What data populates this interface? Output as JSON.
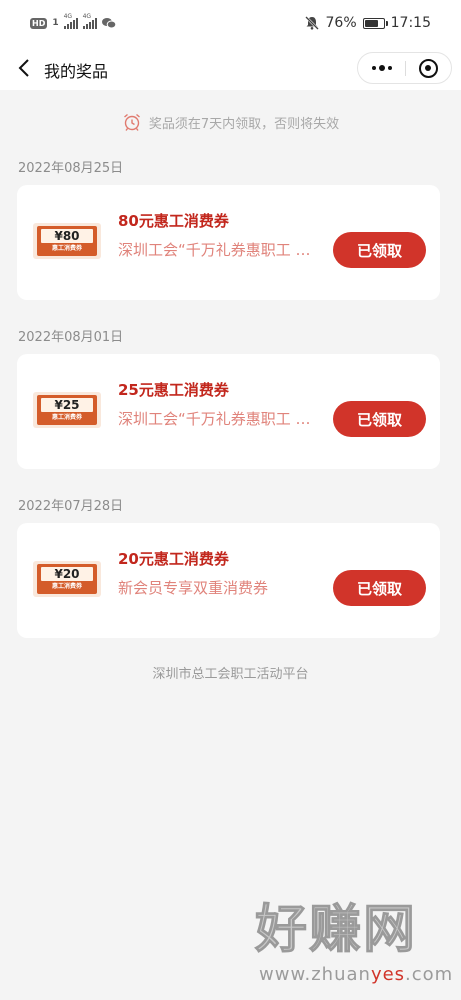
{
  "status_bar": {
    "left_badge": "HD",
    "sim_1": "1",
    "net_1": "4G",
    "net_2": "4G",
    "battery_percent": "76%",
    "battery_level": 0.76,
    "time": "17:15"
  },
  "navbar": {
    "title": "我的奖品"
  },
  "notice": {
    "text": "奖品须在7天内领取，否则将失效"
  },
  "prizes": [
    {
      "date": "2022年08月25日",
      "title": "80元惠工消费券",
      "subtitle": "深圳工会“千万礼券惠职工 …",
      "button": "已领取",
      "thumb_value": "¥80",
      "thumb_label": "惠工消费券"
    },
    {
      "date": "2022年08月01日",
      "title": "25元惠工消费券",
      "subtitle": "深圳工会“千万礼券惠职工 …",
      "button": "已领取",
      "thumb_value": "¥25",
      "thumb_label": "惠工消费券"
    },
    {
      "date": "2022年07月28日",
      "title": "20元惠工消费券",
      "subtitle": "新会员专享双重消费券",
      "button": "已领取",
      "thumb_value": "¥20",
      "thumb_label": "惠工消费券"
    }
  ],
  "footer": {
    "text": "深圳市总工会职工活动平台"
  },
  "watermark": {
    "text": "好赚网",
    "url_start": "www.zhuan",
    "url_highlight": "yes",
    "url_end": ".com"
  },
  "colors": {
    "accent": "#d1342a",
    "title_red": "#c2271d",
    "subtitle": "#e0837b",
    "background": "#f4f4f4"
  }
}
